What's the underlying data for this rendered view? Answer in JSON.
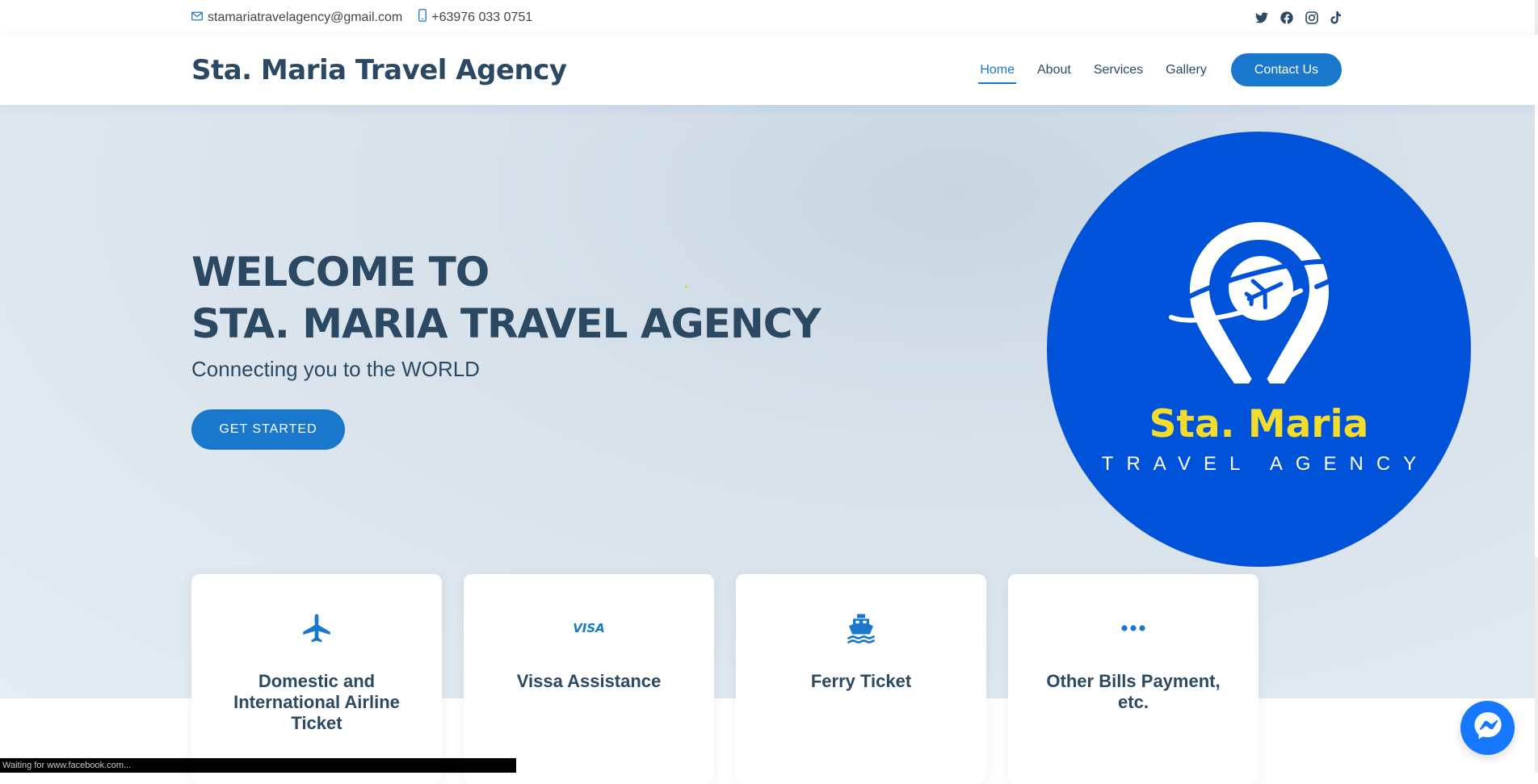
{
  "topbar": {
    "email": "stamariatravelagency@gmail.com",
    "phone": "+63976 033 0751",
    "social": [
      "twitter-icon",
      "facebook-icon",
      "instagram-icon",
      "tiktok-icon"
    ]
  },
  "header": {
    "logo": "Sta. Maria Travel Agency",
    "nav": [
      "Home",
      "About",
      "Services",
      "Gallery"
    ],
    "active_nav": "Home",
    "cta": "Contact Us"
  },
  "hero": {
    "title_line1": "WELCOME TO",
    "title_line2": "STA. MARIA TRAVEL AGENCY",
    "subtitle": "Connecting you to the WORLD",
    "button": "GET STARTED",
    "logo_brand": "Sta. Maria",
    "logo_tagline": "TRAVEL AGENCY"
  },
  "cards": [
    {
      "icon": "airplane-icon",
      "title": "Domestic and International Airline Ticket"
    },
    {
      "icon": "visa-icon",
      "title": "Vissa Assistance"
    },
    {
      "icon": "ferry-icon",
      "title": "Ferry Ticket"
    },
    {
      "icon": "ellipsis-icon",
      "title": "Other Bills Payment, etc."
    }
  ],
  "status_bar": "Waiting for www.facebook.com...",
  "colors": {
    "accent": "#1977cc",
    "heading": "#2c4964",
    "logo_blue": "#0052d9",
    "logo_yellow": "#f3dc2b",
    "messenger": "#1677ff"
  }
}
